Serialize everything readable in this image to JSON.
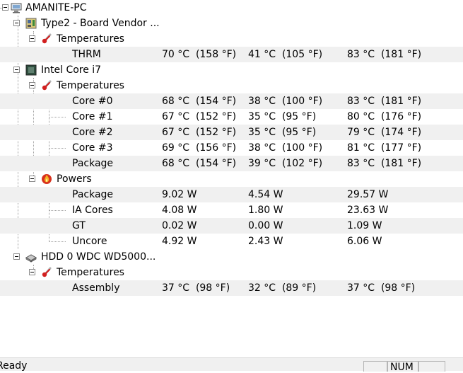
{
  "tree": {
    "computer": {
      "label": "AMANITE-PC",
      "icon": "computer-icon"
    },
    "board": {
      "label": "Type2 - Board Vendor ...",
      "icon": "motherboard-icon"
    },
    "board_temps": {
      "label": "Temperatures",
      "icon": "thermometer-icon"
    },
    "thrm": {
      "label": "THRM",
      "v1": "70 °C  (158 °F)",
      "v2": "41 °C  (105 °F)",
      "v3": "83 °C  (181 °F)"
    },
    "cpu": {
      "label": "Intel Core i7",
      "icon": "cpu-chip-icon"
    },
    "cpu_temps": {
      "label": "Temperatures",
      "icon": "thermometer-icon"
    },
    "core0": {
      "label": "Core #0",
      "v1": "68 °C  (154 °F)",
      "v2": "38 °C  (100 °F)",
      "v3": "83 °C  (181 °F)"
    },
    "core1": {
      "label": "Core #1",
      "v1": "67 °C  (152 °F)",
      "v2": "35 °C  (95 °F)",
      "v3": "80 °C  (176 °F)"
    },
    "core2": {
      "label": "Core #2",
      "v1": "67 °C  (152 °F)",
      "v2": "35 °C  (95 °F)",
      "v3": "79 °C  (174 °F)"
    },
    "core3": {
      "label": "Core #3",
      "v1": "69 °C  (156 °F)",
      "v2": "38 °C  (100 °F)",
      "v3": "81 °C  (177 °F)"
    },
    "pkg_temp": {
      "label": "Package",
      "v1": "68 °C  (154 °F)",
      "v2": "39 °C  (102 °F)",
      "v3": "83 °C  (181 °F)"
    },
    "powers": {
      "label": "Powers",
      "icon": "power-flame-icon"
    },
    "pkg_power": {
      "label": "Package",
      "v1": "9.02 W",
      "v2": "4.54 W",
      "v3": "29.57 W"
    },
    "ia_cores": {
      "label": "IA Cores",
      "v1": "4.08 W",
      "v2": "1.80 W",
      "v3": "23.63 W"
    },
    "gt": {
      "label": "GT",
      "v1": "0.02 W",
      "v2": "0.00 W",
      "v3": "1.09 W"
    },
    "uncore": {
      "label": "Uncore",
      "v1": "4.92 W",
      "v2": "2.43 W",
      "v3": "6.06 W"
    },
    "hdd": {
      "label": "HDD 0 WDC WD5000...",
      "icon": "hard-drive-icon"
    },
    "hdd_temps": {
      "label": "Temperatures",
      "icon": "thermometer-icon"
    },
    "assembly": {
      "label": "Assembly",
      "v1": "37 °C  (98 °F)",
      "v2": "32 °C  (89 °F)",
      "v3": "37 °C  (98 °F)"
    }
  },
  "statusbar": {
    "text": "Ready",
    "num": "NUM"
  }
}
